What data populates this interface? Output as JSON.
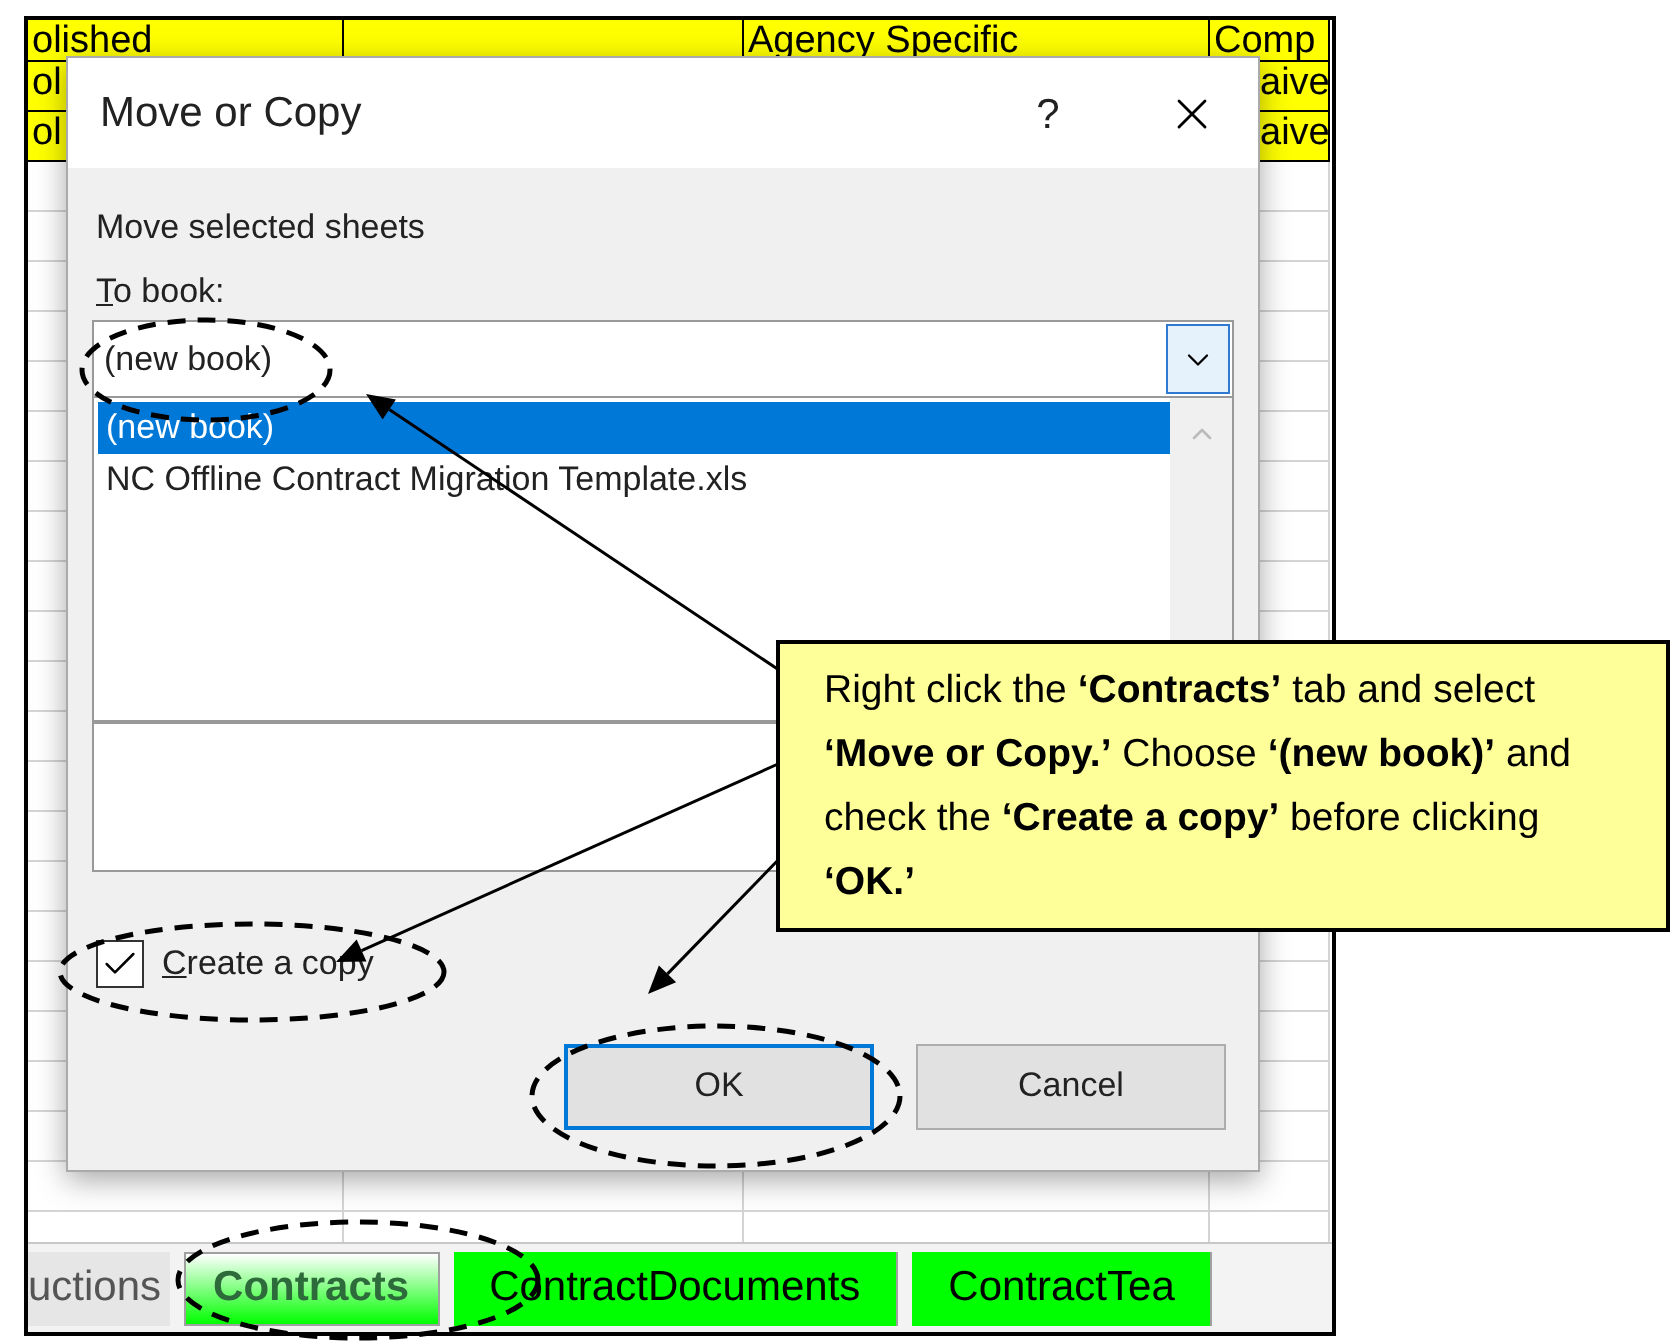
{
  "sheet": {
    "rows": [
      {
        "cells": [
          "olished",
          "",
          "Agency Specific",
          "Comp"
        ],
        "highlighted": true
      },
      {
        "cells": [
          "ol",
          "",
          "",
          "aive"
        ],
        "highlighted": true
      },
      {
        "cells": [
          "ol",
          "",
          "",
          "aive"
        ],
        "highlighted": true
      }
    ]
  },
  "dialog": {
    "title": "Move or Copy",
    "help": "?",
    "heading": "Move selected sheets",
    "to_book_label": "To book:",
    "to_book_value": "(new book)",
    "books": [
      {
        "label": "(new book)",
        "selected": true
      },
      {
        "label": "NC Offline Contract Migration Template.xls",
        "selected": false
      }
    ],
    "create_copy": {
      "label": "Create a copy",
      "checked": true
    },
    "buttons": [
      {
        "label": "OK",
        "default": true
      },
      {
        "label": "Cancel",
        "default": false
      }
    ]
  },
  "sheet_tabs": [
    {
      "label": "uctions",
      "selected": false,
      "color": "#e6e6e6"
    },
    {
      "label": "Contracts",
      "selected": true,
      "color": "#00ff00"
    },
    {
      "label": "ContractDocuments",
      "selected": false,
      "color": "#00ff00"
    },
    {
      "label": "ContractTea",
      "selected": false,
      "color": "#00ff00"
    }
  ],
  "callout": {
    "text": "Right click the **‘Contracts’** tab and select **‘Move or Copy.’** Choose **‘(new book)’** and check the **‘Create a copy’** before clicking **‘OK.’**"
  }
}
